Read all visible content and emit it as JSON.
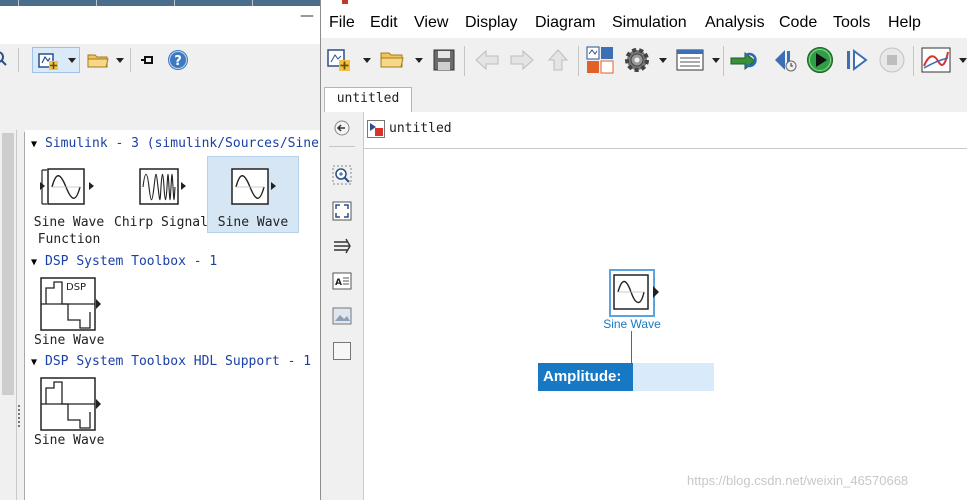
{
  "library_browser": {
    "toolbar_icons": [
      "search-icon",
      "add-block-icon",
      "open-folder-icon",
      "pin-icon",
      "help-icon"
    ],
    "minimize_label": "—",
    "sections": [
      {
        "header": "Simulink - 3 (simulink/Sources/Sine",
        "blocks": [
          {
            "label_line1": "Sine Wave",
            "label_line2": "Function",
            "icon": "sine-wave-function-icon"
          },
          {
            "label_line1": "Chirp Signal",
            "label_line2": "",
            "icon": "chirp-signal-icon"
          },
          {
            "label_line1": "Sine Wave",
            "label_line2": "",
            "icon": "sine-wave-icon",
            "selected": true
          }
        ]
      },
      {
        "header": "DSP System Toolbox - 1",
        "blocks": [
          {
            "label_line1": "Sine Wave",
            "icon": "dsp-sine-wave-icon",
            "icon_text": "DSP"
          }
        ]
      },
      {
        "header": "DSP System Toolbox HDL Support - 1",
        "blocks": [
          {
            "label_line1": "Sine Wave",
            "icon": "dsp-hdl-sine-wave-icon"
          }
        ]
      }
    ]
  },
  "model_window": {
    "menu": [
      "File",
      "Edit",
      "View",
      "Display",
      "Diagram",
      "Simulation",
      "Analysis",
      "Code",
      "Tools",
      "Help"
    ],
    "toolbar_icons": [
      "new-model-icon",
      "open-icon",
      "save-icon",
      "back-icon",
      "forward-icon",
      "up-icon",
      "library-browser-icon",
      "model-settings-icon",
      "model-explorer-icon",
      "update-diagram-icon",
      "step-back-icon",
      "run-icon",
      "step-forward-icon",
      "stop-icon",
      "scope-icon"
    ],
    "tab_label": "untitled",
    "breadcrumb": "untitled",
    "palette_icons": [
      "hide-browser-icon",
      "zoom-icon",
      "fit-view-icon",
      "route-lines-icon",
      "annotation-icon",
      "image-icon",
      "area-icon"
    ],
    "canvas": {
      "block_label": "Sine Wave",
      "param_prompt": "Amplitude:",
      "param_value": ""
    }
  },
  "watermark": "https://blog.csdn.net/weixin_46570668",
  "colors": {
    "accent_blue": "#1779c4",
    "selection_blue": "#5ca4df",
    "library_header_blue": "#1a3fa6",
    "param_field": "#d9ebfb"
  }
}
